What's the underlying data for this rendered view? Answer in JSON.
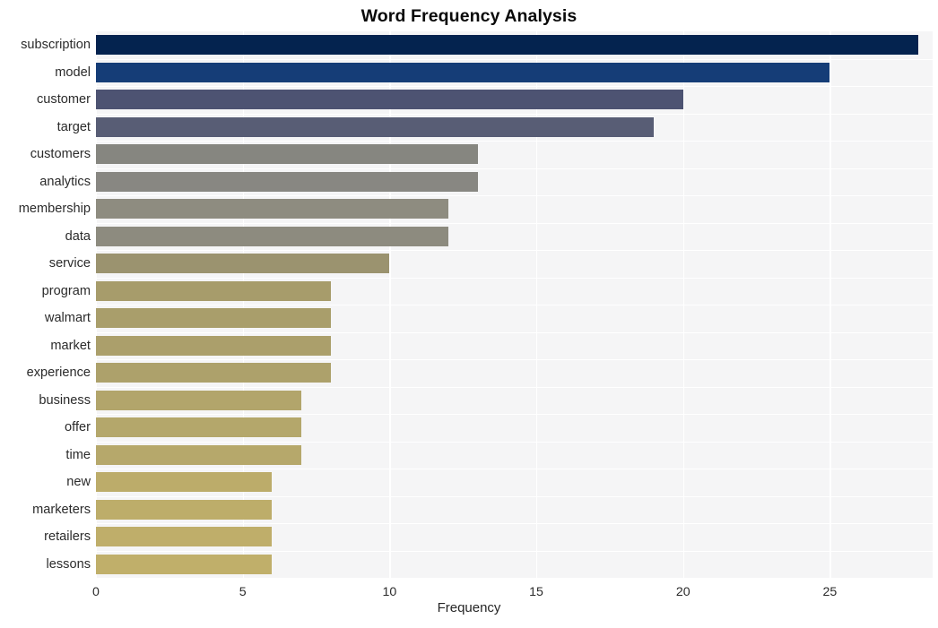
{
  "chart_data": {
    "type": "bar",
    "orientation": "horizontal",
    "title": "Word Frequency Analysis",
    "xlabel": "Frequency",
    "ylabel": "",
    "xlim": [
      0,
      28.5
    ],
    "xticks": [
      0,
      5,
      10,
      15,
      20,
      25
    ],
    "xtick_labels": [
      "0",
      "5",
      "10",
      "15",
      "20",
      "25"
    ],
    "grid": "vertical-white-on-light-gray",
    "legend": "none",
    "categories": [
      "subscription",
      "model",
      "customer",
      "target",
      "customers",
      "analytics",
      "membership",
      "data",
      "service",
      "program",
      "walmart",
      "market",
      "experience",
      "business",
      "offer",
      "time",
      "new",
      "marketers",
      "retailers",
      "lessons"
    ],
    "values": [
      28,
      25,
      20,
      19,
      13,
      13,
      12,
      12,
      10,
      8,
      8,
      8,
      8,
      7,
      7,
      7,
      6,
      6,
      6,
      6
    ],
    "bar_colors": [
      "#04234f",
      "#153d77",
      "#4d5372",
      "#585d75",
      "#868680",
      "#888782",
      "#8e8c80",
      "#8d8b7f",
      "#9b936f",
      "#a79c6b",
      "#a99e6b",
      "#ab9f6b",
      "#ada16b",
      "#b2a56b",
      "#b4a76b",
      "#b6a86b",
      "#bcac6a",
      "#bdad6a",
      "#bfae6a",
      "#c0af6a"
    ],
    "plot_background": "#f5f5f6",
    "gridline_color": "#ffffff",
    "title_color": "#0a0a0a",
    "tick_color": "#2b2b2b"
  }
}
